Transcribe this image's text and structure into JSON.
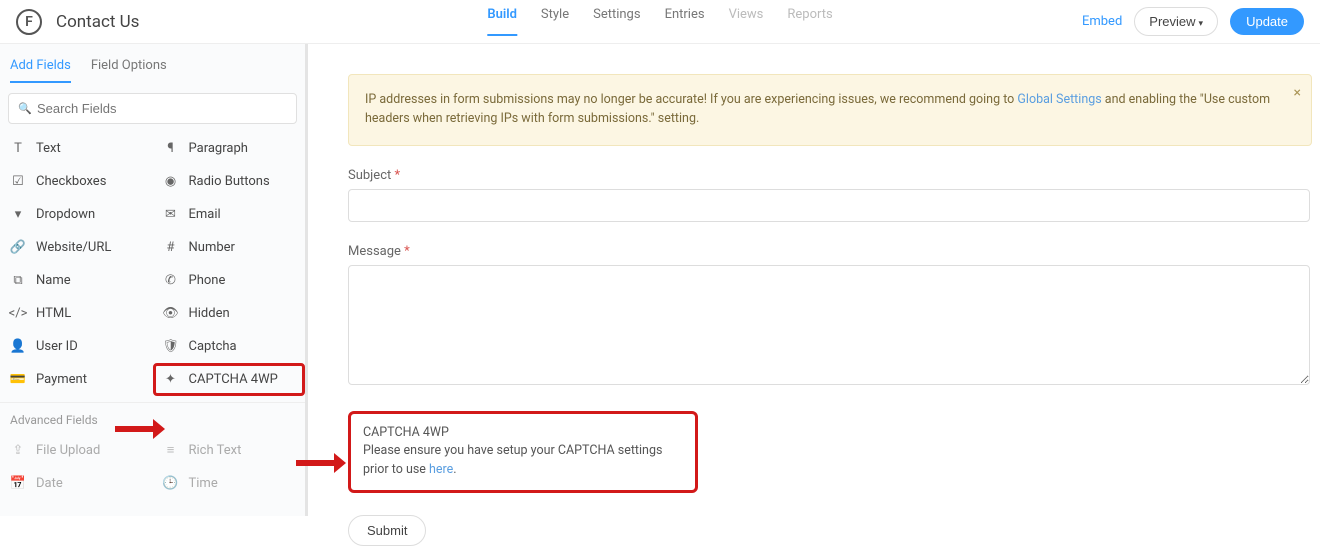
{
  "header": {
    "logo_letter": "F",
    "title": "Contact Us",
    "nav": {
      "build": "Build",
      "style": "Style",
      "settings": "Settings",
      "entries": "Entries",
      "views": "Views",
      "reports": "Reports"
    },
    "embed": "Embed",
    "preview": "Preview",
    "update": "Update"
  },
  "sidebar": {
    "tabs": {
      "add": "Add Fields",
      "options": "Field Options"
    },
    "search_placeholder": "Search Fields",
    "fields": {
      "text": "Text",
      "paragraph": "Paragraph",
      "checkboxes": "Checkboxes",
      "radio": "Radio Buttons",
      "dropdown": "Dropdown",
      "email": "Email",
      "website": "Website/URL",
      "number": "Number",
      "name": "Name",
      "phone": "Phone",
      "html": "HTML",
      "hidden": "Hidden",
      "userid": "User ID",
      "captcha": "Captcha",
      "payment": "Payment",
      "captcha4wp": "CAPTCHA 4WP"
    },
    "advanced_label": "Advanced Fields",
    "advanced": {
      "file_upload": "File Upload",
      "rich_text": "Rich Text",
      "date": "Date",
      "time": "Time"
    }
  },
  "canvas": {
    "notice_pre": "IP addresses in form submissions may no longer be accurate! If you are experiencing issues, we recommend going to ",
    "notice_link": "Global Settings",
    "notice_post": " and enabling the \"Use custom headers when retrieving IPs with form submissions.\" setting.",
    "subject_label": "Subject",
    "message_label": "Message",
    "required_mark": "*",
    "captcha_title": "CAPTCHA 4WP",
    "captcha_text": "Please ensure you have setup your CAPTCHA settings prior to use ",
    "captcha_link": "here",
    "submit": "Submit"
  }
}
